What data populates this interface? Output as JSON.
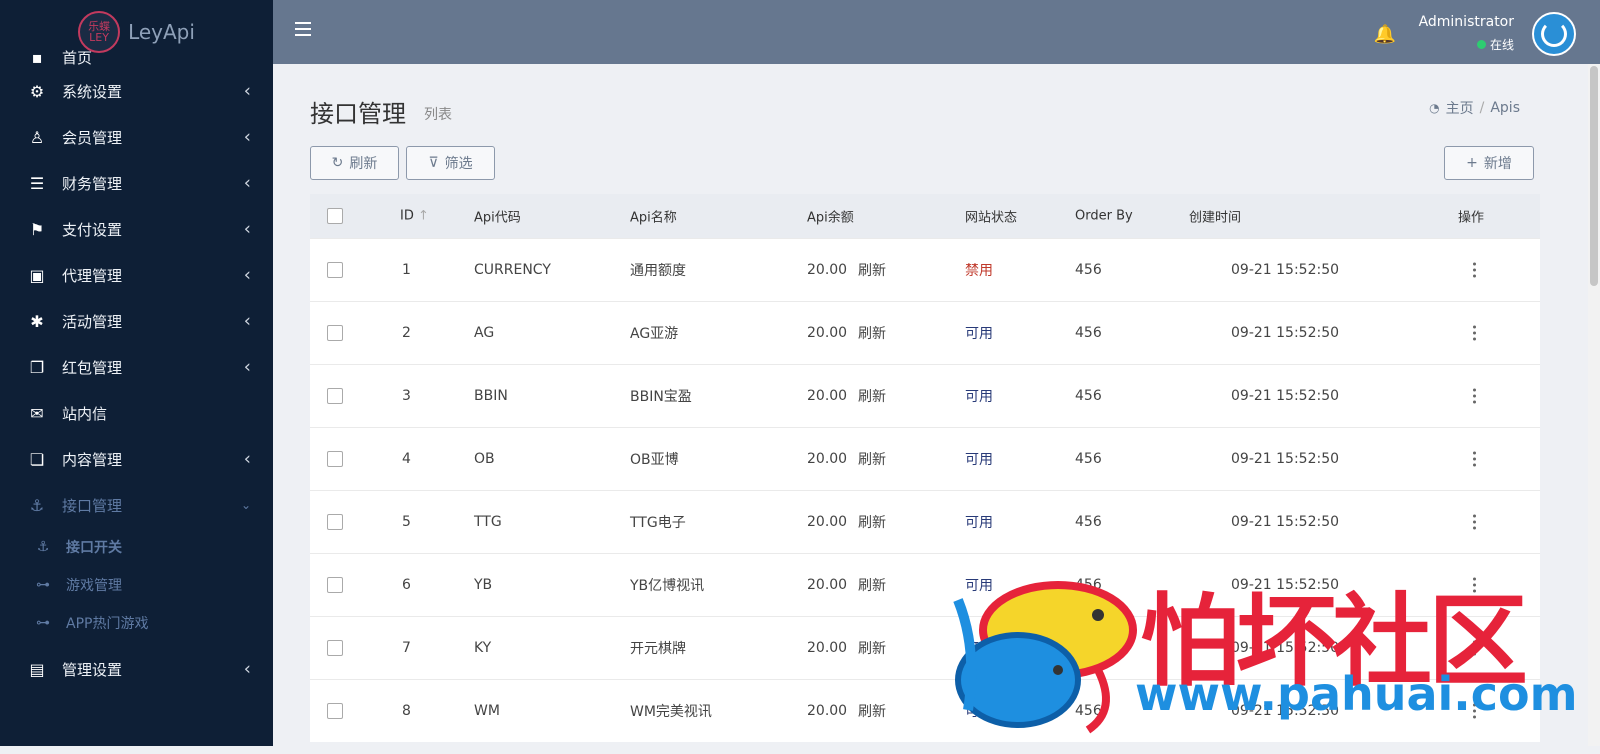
{
  "brand": {
    "logo_text": "乐蝶LEY",
    "name": "LeyApi"
  },
  "sidebar": {
    "top_cut_label": "首页",
    "items": [
      {
        "label": "系统设置",
        "icon": "gears-icon",
        "glyph": "⚙"
      },
      {
        "label": "会员管理",
        "icon": "user-icon",
        "glyph": "♙"
      },
      {
        "label": "财务管理",
        "icon": "database-icon",
        "glyph": "☰"
      },
      {
        "label": "支付设置",
        "icon": "bookmark-icon",
        "glyph": "⚑"
      },
      {
        "label": "代理管理",
        "icon": "contact-card-icon",
        "glyph": "▣"
      },
      {
        "label": "活动管理",
        "icon": "yelp-icon",
        "glyph": "✱"
      },
      {
        "label": "红包管理",
        "icon": "clone-icon",
        "glyph": "❐"
      }
    ],
    "mail_label": "站内信",
    "content_label": "内容管理",
    "api_label": "接口管理",
    "sub_items": [
      {
        "label": "接口开关",
        "icon": "anchor-icon",
        "glyph": "⚓"
      },
      {
        "label": "游戏管理",
        "icon": "gamepad-icon",
        "glyph": "⊶"
      },
      {
        "label": "APP热门游戏",
        "icon": "gamepad-icon",
        "glyph": "⊶"
      }
    ],
    "admin_label": "管理设置"
  },
  "header": {
    "user_name": "Administrator",
    "user_status": "在线"
  },
  "page": {
    "title": "接口管理",
    "subtitle": "列表",
    "breadcrumb_home": "主页",
    "breadcrumb_sep": "/",
    "breadcrumb_current": "Apis"
  },
  "toolbar": {
    "refresh_label": "刷新",
    "filter_label": "筛选",
    "new_label": "新增"
  },
  "table": {
    "headers": {
      "id": "ID",
      "code": "Api代码",
      "name": "Api名称",
      "balance": "Api余额",
      "status": "网站状态",
      "order": "Order By",
      "created": "创建时间",
      "actions": "操作"
    },
    "refresh_text": "刷新",
    "rows": [
      {
        "id": "1",
        "code": "CURRENCY",
        "name": "通用额度",
        "balance": "20.00",
        "status": "禁用",
        "status_type": "off",
        "order": "456",
        "created": "09-21 15:52:50"
      },
      {
        "id": "2",
        "code": "AG",
        "name": "AG亚游",
        "balance": "20.00",
        "status": "可用",
        "status_type": "on",
        "order": "456",
        "created": "09-21 15:52:50"
      },
      {
        "id": "3",
        "code": "BBIN",
        "name": "BBIN宝盈",
        "balance": "20.00",
        "status": "可用",
        "status_type": "on",
        "order": "456",
        "created": "09-21 15:52:50"
      },
      {
        "id": "4",
        "code": "OB",
        "name": "OB亚博",
        "balance": "20.00",
        "status": "可用",
        "status_type": "on",
        "order": "456",
        "created": "09-21 15:52:50"
      },
      {
        "id": "5",
        "code": "TTG",
        "name": "TTG电子",
        "balance": "20.00",
        "status": "可用",
        "status_type": "on",
        "order": "456",
        "created": "09-21 15:52:50"
      },
      {
        "id": "6",
        "code": "YB",
        "name": "YB亿博视讯",
        "balance": "20.00",
        "status": "可用",
        "status_type": "on",
        "order": "456",
        "created": "09-21 15:52:50"
      },
      {
        "id": "7",
        "code": "KY",
        "name": "开元棋牌",
        "balance": "20.00",
        "status": "可用",
        "status_type": "on",
        "order": "456",
        "created": "09-21 15:52:50"
      },
      {
        "id": "8",
        "code": "WM",
        "name": "WM完美视讯",
        "balance": "20.00",
        "status": "可用",
        "status_type": "on",
        "order": "456",
        "created": "09-21 15:52:50"
      }
    ]
  },
  "watermark": {
    "text": "怕坏社区",
    "url": "www.pahuai.com"
  }
}
